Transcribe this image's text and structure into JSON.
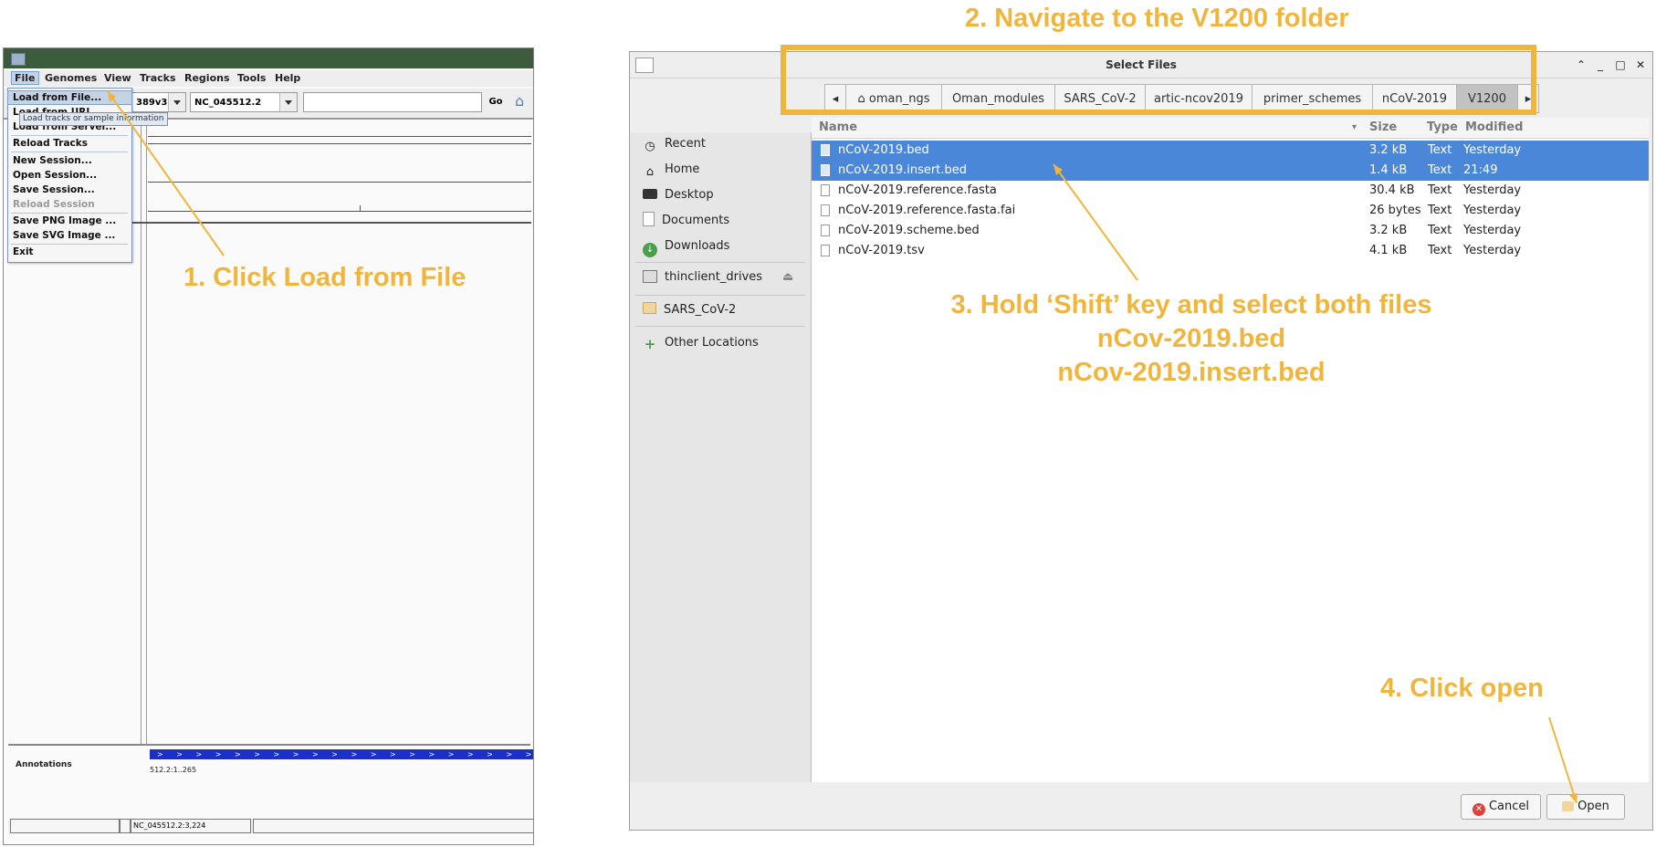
{
  "igv": {
    "menubar": [
      "File",
      "Genomes",
      "View",
      "Tracks",
      "Regions",
      "Tools",
      "Help"
    ],
    "genome_partial": "389v3)",
    "chrom": "NC_045512.2",
    "go_label": "Go",
    "file_menu": {
      "items": [
        {
          "label": "Load from File...",
          "enabled": true,
          "active": true
        },
        {
          "label": "Load from URL...",
          "enabled": true
        },
        {
          "label": "Load from Server...",
          "enabled": true
        },
        {
          "label": "Reload Tracks",
          "enabled": true
        },
        {
          "label": "New Session...",
          "enabled": true
        },
        {
          "label": "Open Session...",
          "enabled": true
        },
        {
          "label": "Save Session...",
          "enabled": true
        },
        {
          "label": "Reload Session",
          "enabled": false
        },
        {
          "label": "Save PNG Image ...",
          "enabled": true
        },
        {
          "label": "Save SVG Image ...",
          "enabled": true
        },
        {
          "label": "Exit",
          "enabled": true
        }
      ],
      "tooltip": "Load tracks or sample information"
    },
    "annotations_label": "Annotations",
    "gene_arrows": "> > > > > > > > > > > > > > > > > > > > > > > > > > > >",
    "gene_label": "512.2:1..265",
    "status_locus": "NC_045512.2:3,224"
  },
  "dialog": {
    "title": "Select Files",
    "breadcrumbs": [
      "oman_ngs",
      "Oman_modules",
      "SARS_CoV-2",
      "artic-ncov2019",
      "primer_schemes",
      "nCoV-2019",
      "V1200"
    ],
    "sidebar": [
      {
        "label": "Recent",
        "icon": "clock-icon"
      },
      {
        "label": "Home",
        "icon": "home-icon"
      },
      {
        "label": "Desktop",
        "icon": "desktop-icon"
      },
      {
        "label": "Documents",
        "icon": "document-icon"
      },
      {
        "label": "Downloads",
        "icon": "download-icon"
      },
      {
        "label": "thinclient_drives",
        "icon": "drive-icon"
      },
      {
        "label": "SARS_CoV-2",
        "icon": "folder-icon"
      },
      {
        "label": "Other Locations",
        "icon": "plus-icon"
      }
    ],
    "columns": [
      "Name",
      "Size",
      "Type",
      "Modified"
    ],
    "files": [
      {
        "name": "nCoV-2019.bed",
        "size": "3.2 kB",
        "type": "Text",
        "modified": "Yesterday",
        "selected": true
      },
      {
        "name": "nCoV-2019.insert.bed",
        "size": "1.4 kB",
        "type": "Text",
        "modified": "21:49",
        "selected": true
      },
      {
        "name": "nCoV-2019.reference.fasta",
        "size": "30.4 kB",
        "type": "Text",
        "modified": "Yesterday",
        "selected": false
      },
      {
        "name": "nCoV-2019.reference.fasta.fai",
        "size": "26 bytes",
        "type": "Text",
        "modified": "Yesterday",
        "selected": false
      },
      {
        "name": "nCoV-2019.scheme.bed",
        "size": "3.2 kB",
        "type": "Text",
        "modified": "Yesterday",
        "selected": false
      },
      {
        "name": "nCoV-2019.tsv",
        "size": "4.1 kB",
        "type": "Text",
        "modified": "Yesterday",
        "selected": false
      }
    ],
    "cancel_label": "Cancel",
    "open_label": "Open"
  },
  "annotations": {
    "step1": "1. Click Load from File",
    "step2": "2. Navigate to the V1200 folder",
    "step3_line1": "3. Hold ‘Shift’ key and select both files",
    "step3_line2": "nCov-2019.bed",
    "step3_line3": "nCov-2019.insert.bed",
    "step4": "4. Click open"
  },
  "colors": {
    "annotation": "#f0b53c",
    "selection": "#4a87d9",
    "gene": "#1c2fc7"
  }
}
